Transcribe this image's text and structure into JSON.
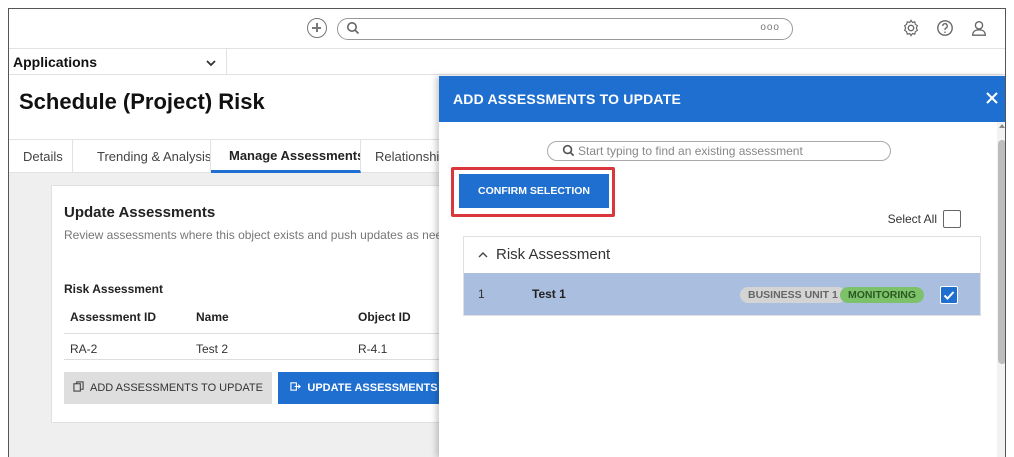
{
  "topbar": {
    "add_icon": "plus-circle-icon",
    "search_icon": "search-icon",
    "search_placeholder": "",
    "more_dots": "ooo",
    "icons": [
      "gear-icon",
      "help-icon",
      "user-icon"
    ]
  },
  "appbar": {
    "label": "Applications"
  },
  "page": {
    "title": "Schedule (Project) Risk",
    "tabs": [
      {
        "label": "Details",
        "active": false
      },
      {
        "label": "Trending & Analysis",
        "active": false
      },
      {
        "label": "Manage Assessments",
        "active": true
      },
      {
        "label": "Relationshi",
        "active": false
      }
    ]
  },
  "card": {
    "title": "Update Assessments",
    "description": "Review assessments where this object exists and push updates as neede",
    "section_title": "Risk Assessment",
    "columns": [
      "Assessment ID",
      "Name",
      "Object ID"
    ],
    "rows": [
      {
        "id": "RA-2",
        "name": "Test 2",
        "object_id": "R-4.1"
      }
    ],
    "add_button": "ADD ASSESSMENTS TO UPDATE",
    "update_button": "UPDATE ASSESSMENTS"
  },
  "panel": {
    "title": "ADD ASSESSMENTS TO UPDATE",
    "search_placeholder": "Start typing to find an existing assessment",
    "confirm_button": "CONFIRM SELECTION",
    "select_all_label": "Select All",
    "group": {
      "name": "Risk Assessment",
      "rows": [
        {
          "num": "1",
          "name": "Test 1",
          "badge_unit": "BUSINESS UNIT 1",
          "badge_status": "MONITORING",
          "checked": true
        }
      ]
    }
  },
  "colors": {
    "primary": "#1f6fd1",
    "highlight": "#d9373c",
    "selected_row": "#aabfe0",
    "monitoring": "#7dc26a"
  }
}
